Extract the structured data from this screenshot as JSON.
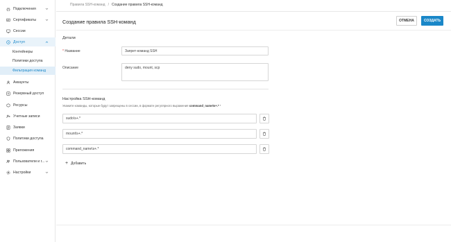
{
  "sidebar": {
    "items": [
      {
        "label": "Подключения",
        "icon": "plug-icon",
        "chevron": "down"
      },
      {
        "label": "Сертификаты",
        "icon": "certificate-icon",
        "chevron": "down"
      },
      {
        "label": "Сессии",
        "icon": "monitor-icon"
      },
      {
        "label": "Доступ",
        "icon": "access-icon",
        "chevron": "up",
        "active": true
      },
      {
        "label": "Аккаунты",
        "icon": "account-icon"
      },
      {
        "label": "Резервный доступ",
        "icon": "backup-icon"
      },
      {
        "label": "Ресурсы",
        "icon": "resource-icon"
      },
      {
        "label": "Учетные записи",
        "icon": "credentials-icon"
      },
      {
        "label": "Заявки",
        "icon": "request-icon"
      },
      {
        "label": "Политики доступа",
        "icon": "policy-icon"
      },
      {
        "label": "Приложения",
        "icon": "apps-icon"
      },
      {
        "label": "Пользователи и г...",
        "icon": "users-icon",
        "chevron": "down"
      },
      {
        "label": "Настройки",
        "icon": "gear-icon",
        "chevron": "down"
      }
    ],
    "subitems": [
      {
        "label": "Контейнеры"
      },
      {
        "label": "Политики доступа"
      },
      {
        "label": "Фильтрация команд",
        "active": true
      }
    ]
  },
  "breadcrumb": {
    "parent": "Правила SSH-команд",
    "separator": "/",
    "current": "Создание правила SSH-команд"
  },
  "header": {
    "title": "Создание правила SSH-команд",
    "cancel_label": "ОТМЕНА",
    "create_label": "СОЗДАТЬ"
  },
  "details": {
    "title": "Детали",
    "name_label": "Название",
    "name_required": "*",
    "name_value": "Запрет-команд SSH",
    "description_label": "Описание",
    "description_value": "deny sudo, mount, scp"
  },
  "ssh_settings": {
    "title": "Настройка SSH-команд",
    "hint_prefix": "Укажите команды, которые будут запрещены в сессии, в формате регулярного выражения ",
    "hint_example": "command_name\\s+.*",
    "commands": [
      "sudo\\s+.*",
      "mount\\s+.*",
      "command_name\\s+.*"
    ],
    "add_label": "Добавить"
  },
  "colors": {
    "accent": "#1a87c8",
    "active_bg": "#e9f3fa"
  }
}
